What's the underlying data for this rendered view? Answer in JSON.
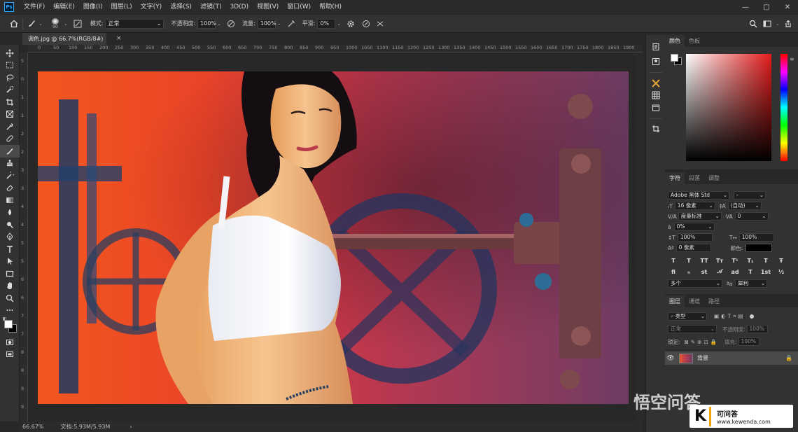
{
  "menu": [
    "文件(F)",
    "编辑(E)",
    "图像(I)",
    "图层(L)",
    "文字(Y)",
    "选择(S)",
    "滤镜(T)",
    "3D(D)",
    "视图(V)",
    "窗口(W)",
    "帮助(H)"
  ],
  "app_logo": "Ps",
  "window_controls": {
    "minimize": "—",
    "restore": "▢",
    "close": "✕"
  },
  "options": {
    "brush_size": "90",
    "mode_label": "模式:",
    "mode_value": "正常",
    "opacity_label": "不透明度:",
    "opacity_value": "100%",
    "flow_label": "流量:",
    "flow_value": "100%",
    "smooth_label": "平滑:",
    "smooth_value": "0%"
  },
  "document": {
    "tab_title": "调色.jpg @ 66.7%(RGB/8#)",
    "close": "×",
    "zoom": "66.67%",
    "doc_info": "文档:5.93M/5.93M",
    "status_arrow": "›"
  },
  "ruler": {
    "top": [
      "0",
      "50",
      "100",
      "150",
      "200",
      "250",
      "300",
      "350",
      "400",
      "450",
      "500",
      "550",
      "600",
      "650",
      "700",
      "750",
      "800",
      "850",
      "900",
      "950",
      "1000",
      "1050",
      "1100",
      "1150",
      "1200",
      "1250",
      "1300",
      "1350",
      "1400",
      "1450",
      "1500",
      "1550",
      "1600",
      "1650",
      "1700",
      "1750",
      "1800",
      "1850",
      "1900"
    ],
    "left": [
      "5",
      "0",
      "1",
      "1",
      "2",
      "2",
      "3",
      "3",
      "4",
      "4",
      "5",
      "5",
      "6",
      "6",
      "7",
      "7",
      "8",
      "8",
      "9",
      "9"
    ]
  },
  "tools": [
    "move-icon",
    "marquee-icon",
    "lasso-icon",
    "quick-select-icon",
    "crop-icon",
    "frame-icon",
    "eyedropper-icon",
    "healing-icon",
    "brush-icon",
    "stamp-icon",
    "history-brush-icon",
    "eraser-icon",
    "gradient-icon",
    "blur-icon",
    "dodge-icon",
    "pen-icon",
    "type-icon",
    "path-select-icon",
    "rectangle-icon",
    "hand-icon",
    "zoom-icon",
    "more-icon"
  ],
  "color_panel": {
    "tabs": [
      "颜色",
      "色板"
    ]
  },
  "character_panel": {
    "tabs": [
      "字符",
      "段落",
      "调整"
    ],
    "font_family": "Adobe 黑体 Std",
    "font_style": "-",
    "font_size": "16 像素",
    "leading": "(自动)",
    "kerning": "度量标准",
    "tracking": "0",
    "vscale_pct": "0%",
    "vert_scale": "100%",
    "horiz_scale": "100%",
    "baseline": "0 像素",
    "color_label": "颜色:",
    "glyph_buttons": [
      "T",
      "T",
      "TT",
      "Tт",
      "T¹",
      "T₁",
      "T",
      "Ŧ"
    ],
    "glyph_buttons2": [
      "fi",
      "ℴ",
      "st",
      "𝒜",
      "ad",
      "T",
      "1st",
      "½"
    ],
    "language": "多个",
    "aa_label": "ªa",
    "antialias": "犀利"
  },
  "layers_panel": {
    "tabs": [
      "图层",
      "通道",
      "路径"
    ],
    "filter": "类型",
    "blend_mode": "正常",
    "opacity_label": "不透明度:",
    "opacity_value": "100%",
    "lock_label": "锁定:",
    "fill_label": "填充:",
    "fill_value": "100%",
    "layers": [
      {
        "name": "背景",
        "visible": true,
        "locked": true
      }
    ]
  },
  "watermark": {
    "logo": "K",
    "text": "可问答",
    "url": "www.kewenda.com",
    "overlay": "悟空问答"
  },
  "colors": {
    "foreground": "#ffffff",
    "background": "#000000",
    "accent": "#31a8ff"
  }
}
